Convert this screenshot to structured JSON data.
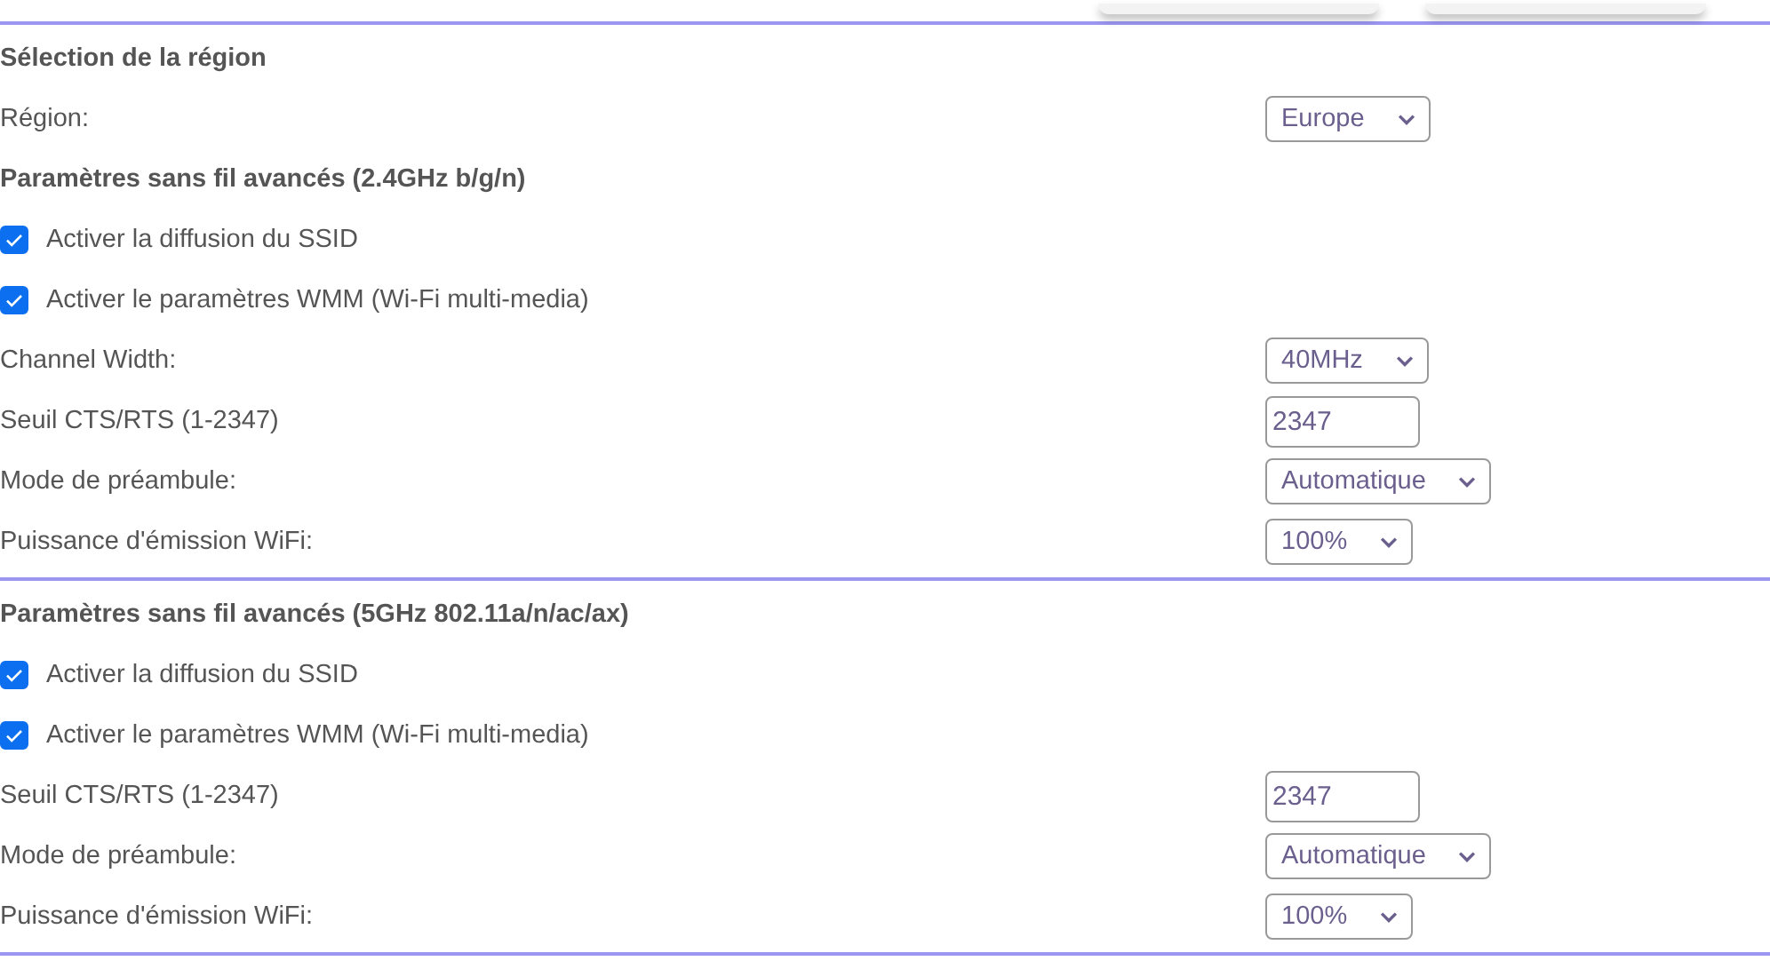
{
  "top_buttons": [
    {
      "kind": "button"
    },
    {
      "kind": "button"
    }
  ],
  "sections": [
    {
      "items": [
        {
          "kind": "heading",
          "label": "Sélection de la région"
        },
        {
          "kind": "select",
          "label": "Région:",
          "value": "Europe"
        },
        {
          "kind": "heading",
          "label": "Paramètres sans fil avancés (2.4GHz b/g/n)"
        },
        {
          "kind": "checkbox",
          "label": "Activer la diffusion du SSID",
          "checked": true
        },
        {
          "kind": "checkbox",
          "label": "Activer le paramètres WMM (Wi-Fi multi-media)",
          "checked": true
        },
        {
          "kind": "select",
          "label": "Channel Width:",
          "value": "40MHz"
        },
        {
          "kind": "input",
          "label": "Seuil CTS/RTS (1-2347)",
          "value": "2347"
        },
        {
          "kind": "select",
          "label": "Mode de préambule:",
          "value": "Automatique"
        },
        {
          "kind": "select",
          "label": "Puissance d'émission WiFi:",
          "value": "100%"
        }
      ]
    },
    {
      "items": [
        {
          "kind": "heading",
          "label": "Paramètres sans fil avancés (5GHz 802.11a/n/ac/ax)"
        },
        {
          "kind": "checkbox",
          "label": "Activer la diffusion du SSID",
          "checked": true
        },
        {
          "kind": "checkbox",
          "label": "Activer le paramètres WMM (Wi-Fi multi-media)",
          "checked": true
        },
        {
          "kind": "input",
          "label": "Seuil CTS/RTS (1-2347)",
          "value": "2347"
        },
        {
          "kind": "select",
          "label": "Mode de préambule:",
          "value": "Automatique"
        },
        {
          "kind": "select",
          "label": "Puissance d'émission WiFi:",
          "value": "100%"
        }
      ]
    }
  ]
}
